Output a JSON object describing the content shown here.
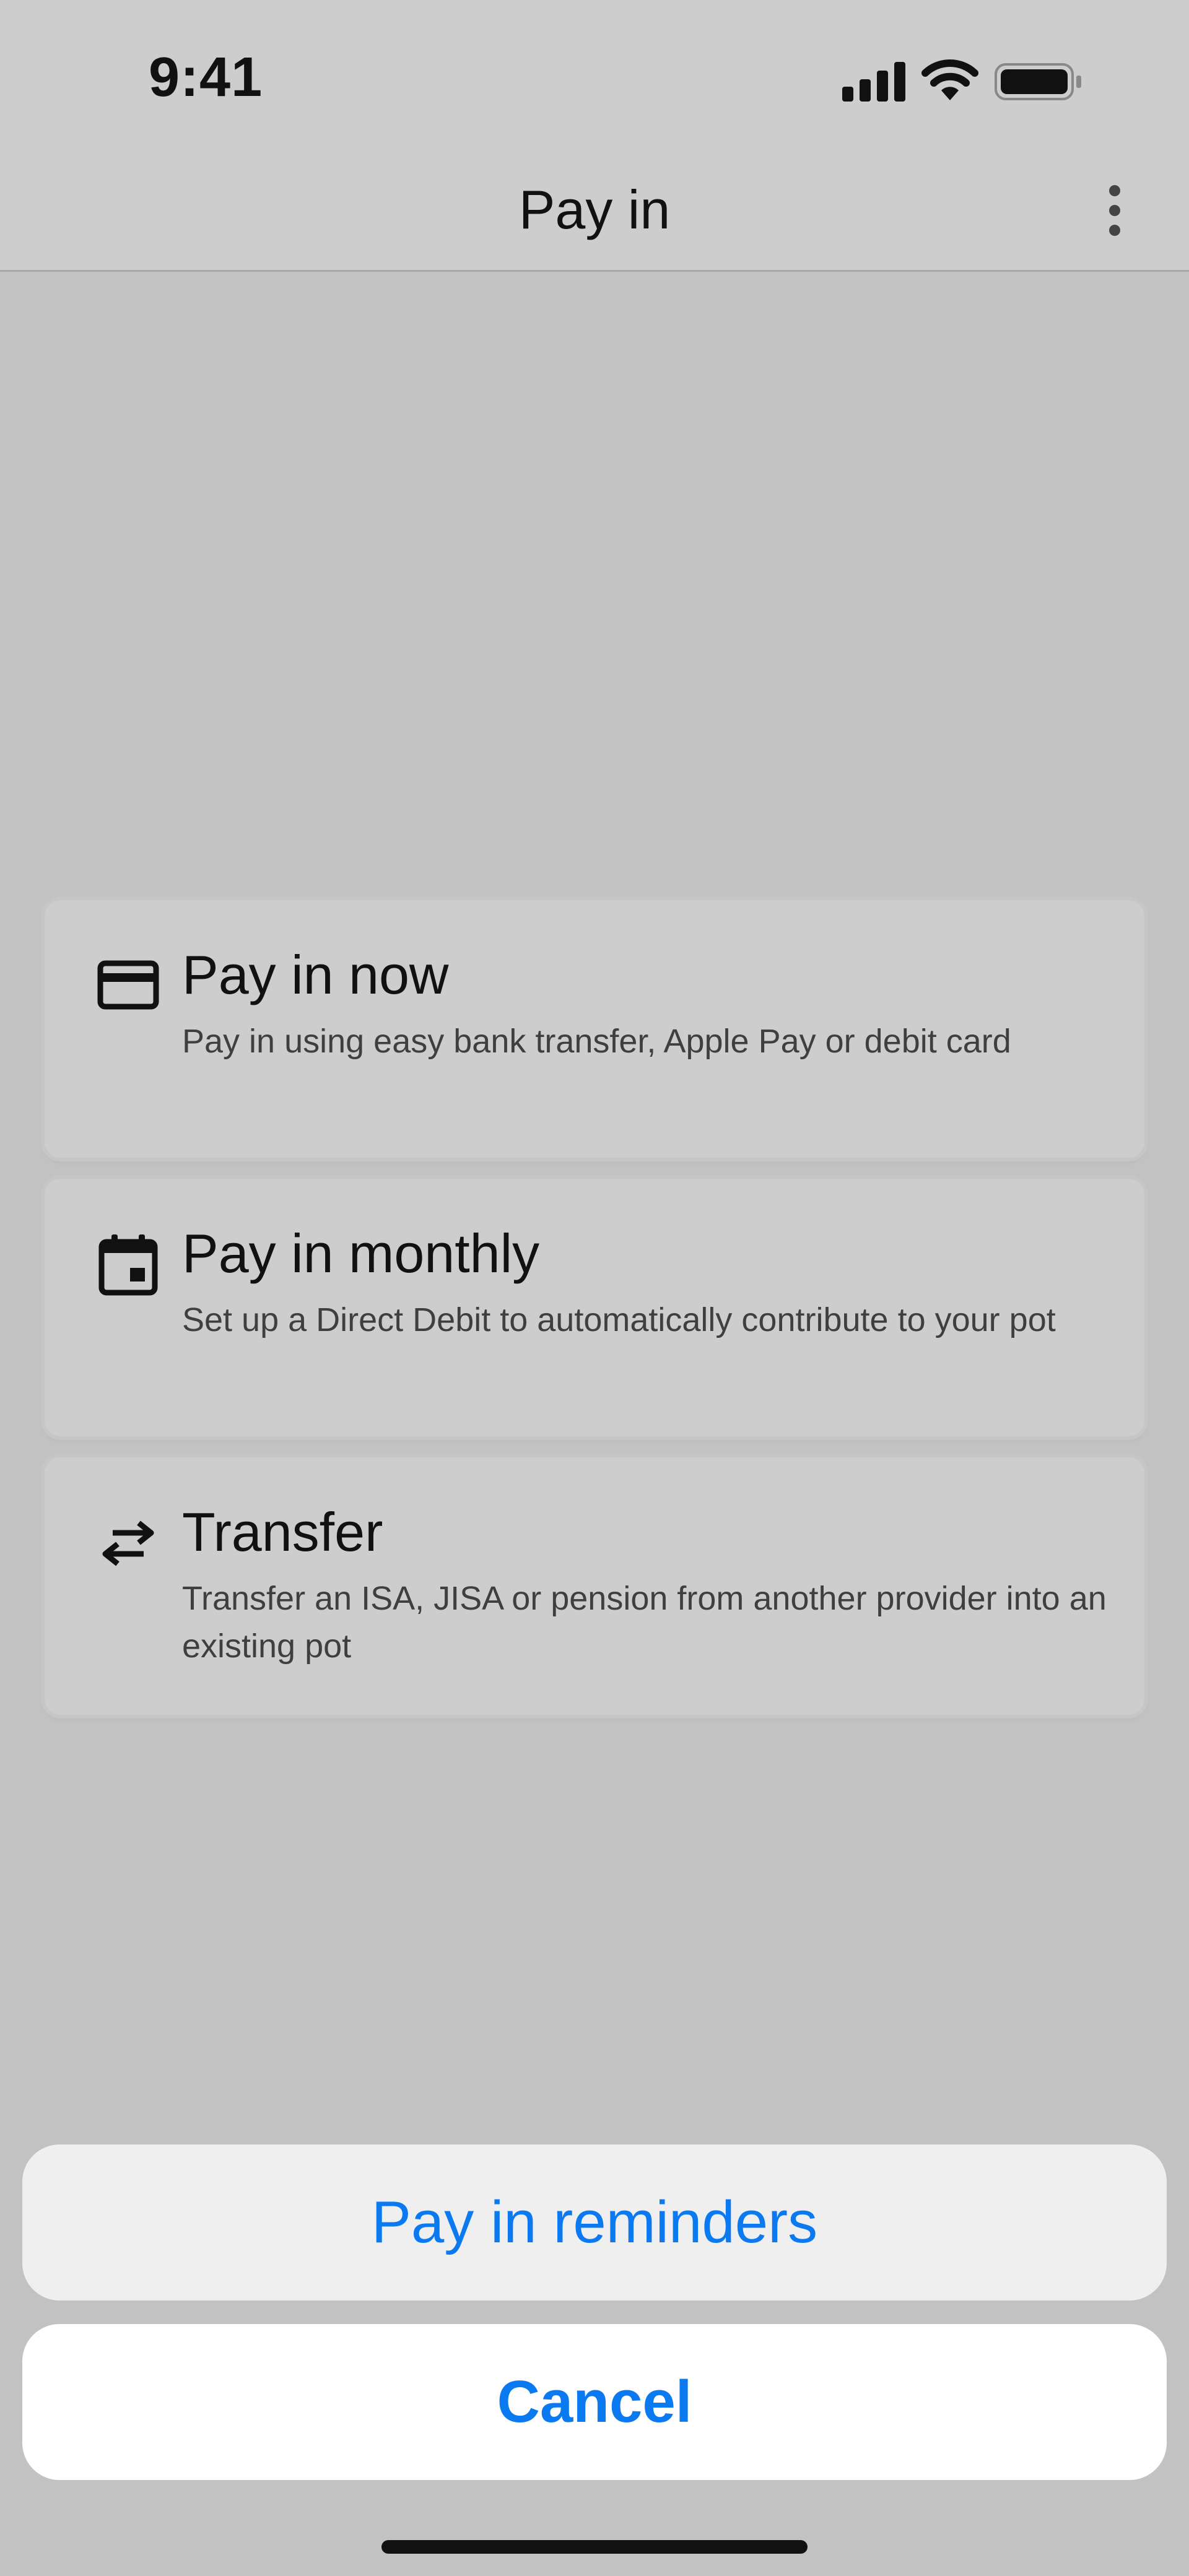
{
  "status_bar": {
    "time": "9:41",
    "icons": [
      "cellular-signal-icon",
      "wifi-icon",
      "battery-icon"
    ]
  },
  "nav": {
    "title": "Pay in",
    "more_icon": "more-vertical-icon"
  },
  "options": [
    {
      "icon": "credit-card-icon",
      "title": "Pay in now",
      "description": "Pay in using easy bank transfer, Apple Pay or debit card"
    },
    {
      "icon": "calendar-icon",
      "title": "Pay in monthly",
      "description": "Set up a Direct Debit to automatically contribute to your pot"
    },
    {
      "icon": "transfer-arrows-icon",
      "title": "Transfer",
      "description": "Transfer an ISA, JISA or pension from another provider into an existing pot"
    }
  ],
  "action_sheet": {
    "reminders_label": "Pay in reminders",
    "cancel_label": "Cancel"
  },
  "colors": {
    "accent": "#0b7af0",
    "overlay_background": "#c2c2c2",
    "card_background": "#cdcdcd"
  }
}
